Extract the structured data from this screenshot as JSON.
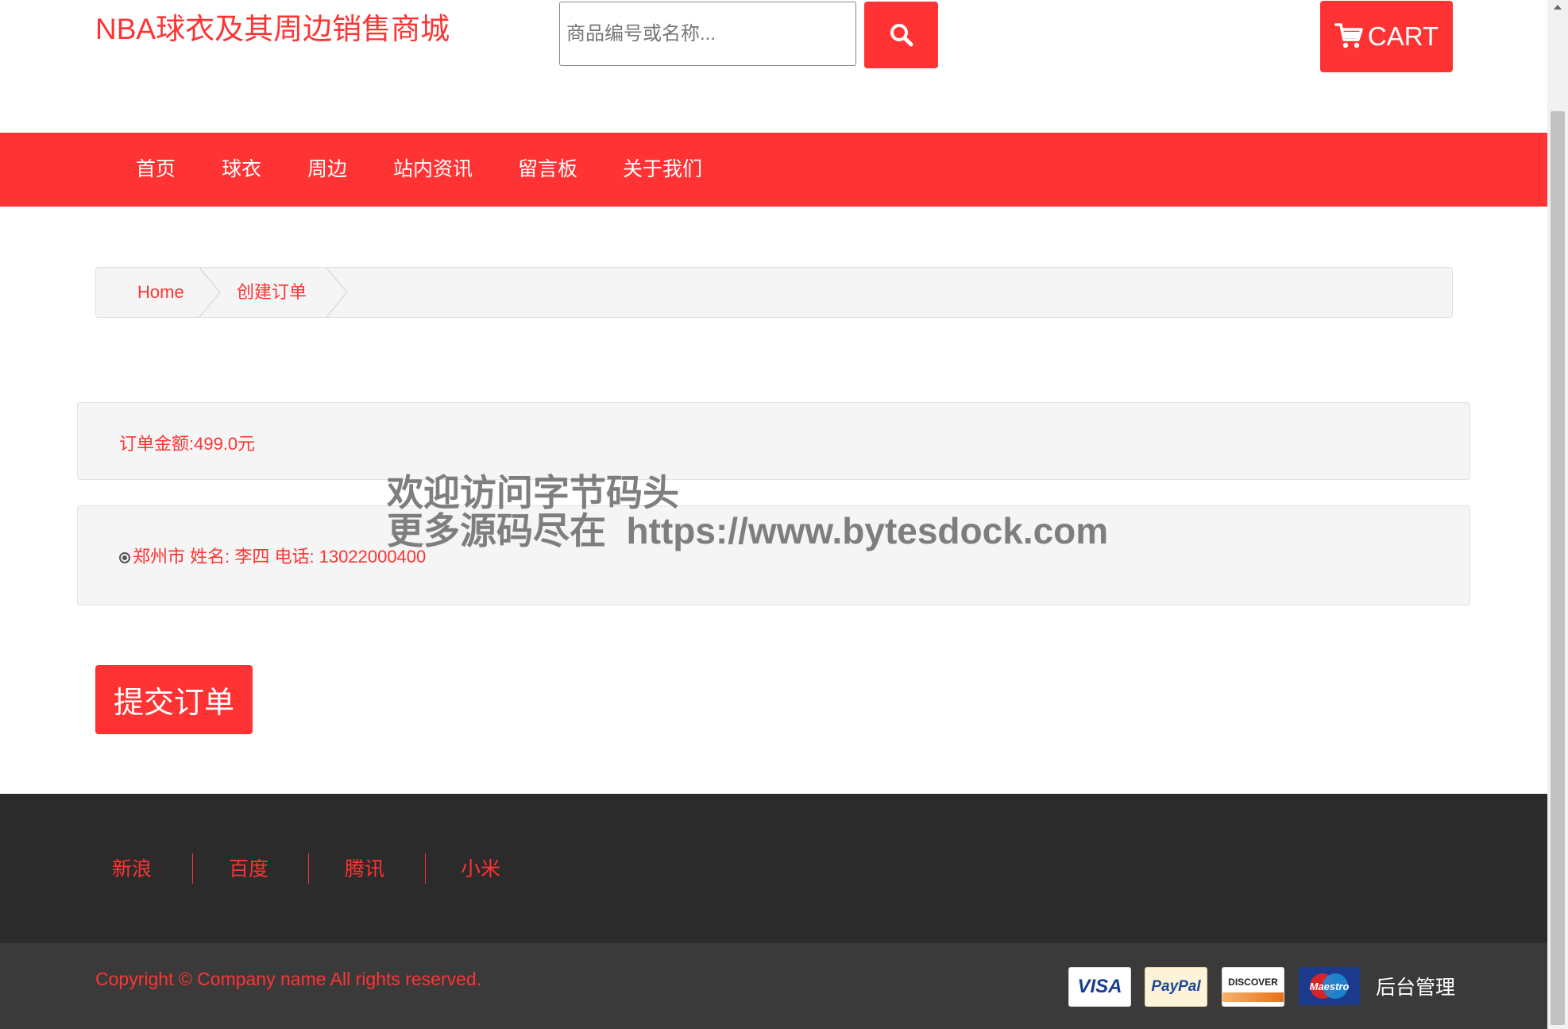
{
  "header": {
    "brand": "NBA球衣及其周边销售商城",
    "search": {
      "placeholder": "商品编号或名称...",
      "icon": "search-icon"
    },
    "cart_label": "CART"
  },
  "nav": {
    "items": [
      {
        "label": "首页"
      },
      {
        "label": "球衣"
      },
      {
        "label": "周边"
      },
      {
        "label": "站内资讯"
      },
      {
        "label": "留言板"
      },
      {
        "label": "关于我们"
      }
    ]
  },
  "breadcrumb": [
    {
      "label": "Home"
    },
    {
      "label": "创建订单"
    }
  ],
  "order": {
    "amount_text": "订单金额:499.0元",
    "address_text": "郑州市 姓名: 李四 电话: 13022000400"
  },
  "watermark": {
    "line1": "欢迎访问字节码头",
    "line2": "更多源码尽在  https://www.bytesdock.com"
  },
  "submit_label": "提交订单",
  "footer": {
    "links": [
      {
        "label": "新浪"
      },
      {
        "label": "百度"
      },
      {
        "label": "腾讯"
      },
      {
        "label": "小米"
      }
    ],
    "copyright": "Copyright © Company name All rights reserved.",
    "payments": [
      {
        "label": "VISA"
      },
      {
        "label": "PayPal"
      },
      {
        "label": "DISCOVER"
      },
      {
        "label": "Maestro"
      }
    ],
    "admin_label": "后台管理"
  },
  "colors": {
    "accent": "#ff3333",
    "footer_dark": "#2b2b2b",
    "footer_bottom": "#3a3a3a",
    "panel_bg": "#f5f5f5"
  }
}
